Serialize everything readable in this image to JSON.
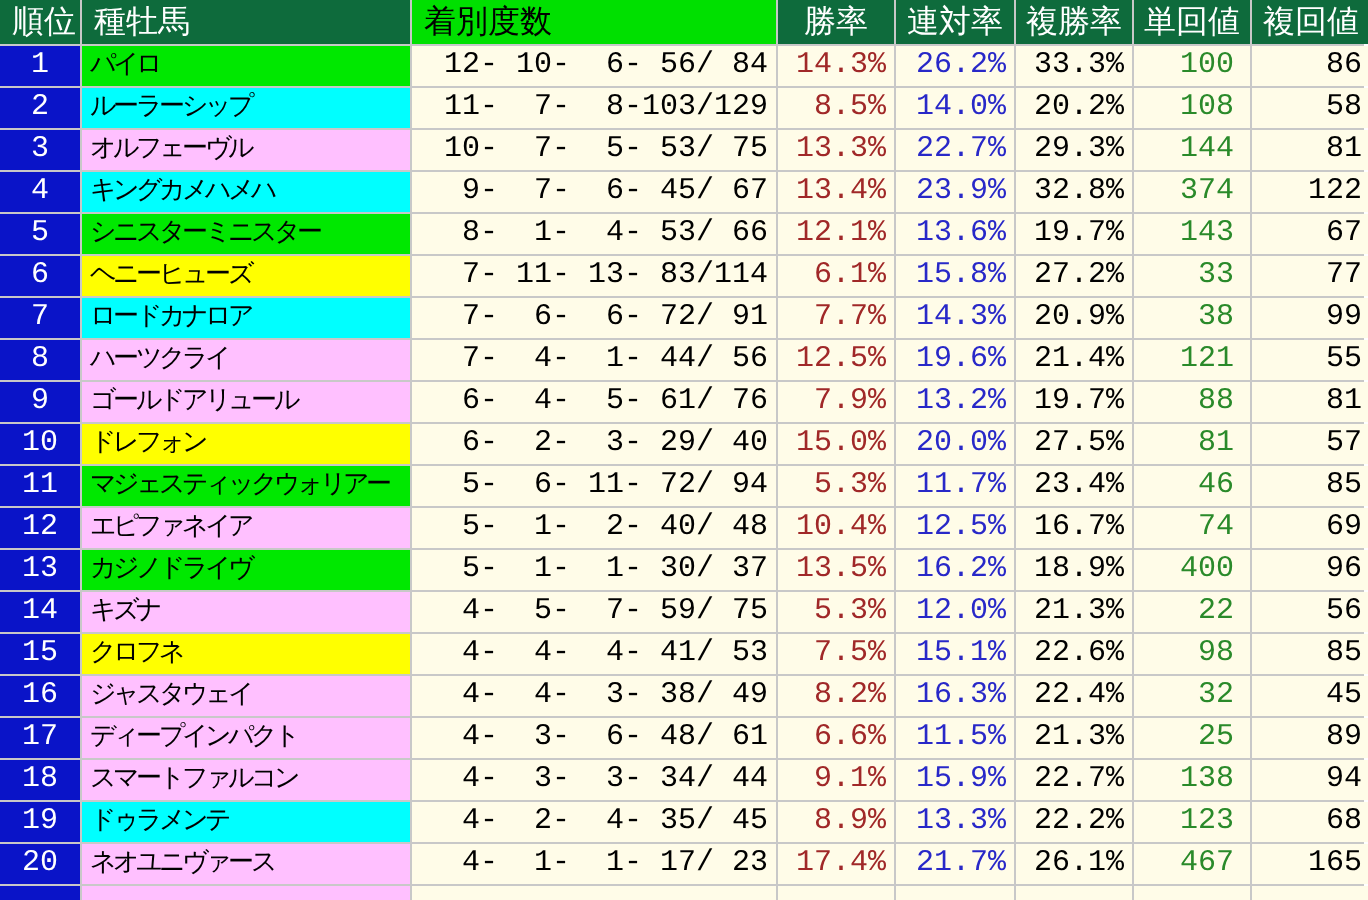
{
  "table": {
    "columns": [
      "順位",
      "種牡馬",
      "着別度数",
      "勝率",
      "連対率",
      "複勝率",
      "単回値",
      "複回値"
    ],
    "rows": [
      {
        "rank": "1",
        "sire": "パイロ",
        "color": "#00e800",
        "record": "12- 10-  6- 56/ 84",
        "win": "14.3%",
        "quinella": "26.2%",
        "place": "33.3%",
        "win_return": "100",
        "place_return": "86"
      },
      {
        "rank": "2",
        "sire": "ルーラーシップ",
        "color": "#00ffff",
        "record": "11-  7-  8-103/129",
        "win": "8.5%",
        "quinella": "14.0%",
        "place": "20.2%",
        "win_return": "108",
        "place_return": "58"
      },
      {
        "rank": "3",
        "sire": "オルフェーヴル",
        "color": "#ffc0ff",
        "record": "10-  7-  5- 53/ 75",
        "win": "13.3%",
        "quinella": "22.7%",
        "place": "29.3%",
        "win_return": "144",
        "place_return": "81"
      },
      {
        "rank": "4",
        "sire": "キングカメハメハ",
        "color": "#00ffff",
        "record": " 9-  7-  6- 45/ 67",
        "win": "13.4%",
        "quinella": "23.9%",
        "place": "32.8%",
        "win_return": "374",
        "place_return": "122"
      },
      {
        "rank": "5",
        "sire": "シニスターミニスター",
        "color": "#00e800",
        "record": " 8-  1-  4- 53/ 66",
        "win": "12.1%",
        "quinella": "13.6%",
        "place": "19.7%",
        "win_return": "143",
        "place_return": "67"
      },
      {
        "rank": "6",
        "sire": "ヘニーヒューズ",
        "color": "#ffff00",
        "record": " 7- 11- 13- 83/114",
        "win": "6.1%",
        "quinella": "15.8%",
        "place": "27.2%",
        "win_return": "33",
        "place_return": "77"
      },
      {
        "rank": "7",
        "sire": "ロードカナロア",
        "color": "#00ffff",
        "record": " 7-  6-  6- 72/ 91",
        "win": "7.7%",
        "quinella": "14.3%",
        "place": "20.9%",
        "win_return": "38",
        "place_return": "99"
      },
      {
        "rank": "8",
        "sire": "ハーツクライ",
        "color": "#ffc0ff",
        "record": " 7-  4-  1- 44/ 56",
        "win": "12.5%",
        "quinella": "19.6%",
        "place": "21.4%",
        "win_return": "121",
        "place_return": "55"
      },
      {
        "rank": "9",
        "sire": "ゴールドアリュール",
        "color": "#ffc0ff",
        "record": " 6-  4-  5- 61/ 76",
        "win": "7.9%",
        "quinella": "13.2%",
        "place": "19.7%",
        "win_return": "88",
        "place_return": "81"
      },
      {
        "rank": "10",
        "sire": "ドレフォン",
        "color": "#ffff00",
        "record": " 6-  2-  3- 29/ 40",
        "win": "15.0%",
        "quinella": "20.0%",
        "place": "27.5%",
        "win_return": "81",
        "place_return": "57"
      },
      {
        "rank": "11",
        "sire": "マジェスティックウォリアー",
        "color": "#00e800",
        "record": " 5-  6- 11- 72/ 94",
        "win": "5.3%",
        "quinella": "11.7%",
        "place": "23.4%",
        "win_return": "46",
        "place_return": "85"
      },
      {
        "rank": "12",
        "sire": "エピファネイア",
        "color": "#ffc0ff",
        "record": " 5-  1-  2- 40/ 48",
        "win": "10.4%",
        "quinella": "12.5%",
        "place": "16.7%",
        "win_return": "74",
        "place_return": "69"
      },
      {
        "rank": "13",
        "sire": "カジノドライヴ",
        "color": "#00e800",
        "record": " 5-  1-  1- 30/ 37",
        "win": "13.5%",
        "quinella": "16.2%",
        "place": "18.9%",
        "win_return": "400",
        "place_return": "96"
      },
      {
        "rank": "14",
        "sire": "キズナ",
        "color": "#ffc0ff",
        "record": " 4-  5-  7- 59/ 75",
        "win": "5.3%",
        "quinella": "12.0%",
        "place": "21.3%",
        "win_return": "22",
        "place_return": "56"
      },
      {
        "rank": "15",
        "sire": "クロフネ",
        "color": "#ffff00",
        "record": " 4-  4-  4- 41/ 53",
        "win": "7.5%",
        "quinella": "15.1%",
        "place": "22.6%",
        "win_return": "98",
        "place_return": "85"
      },
      {
        "rank": "16",
        "sire": "ジャスタウェイ",
        "color": "#ffc0ff",
        "record": " 4-  4-  3- 38/ 49",
        "win": "8.2%",
        "quinella": "16.3%",
        "place": "22.4%",
        "win_return": "32",
        "place_return": "45"
      },
      {
        "rank": "17",
        "sire": "ディープインパクト",
        "color": "#ffc0ff",
        "record": " 4-  3-  6- 48/ 61",
        "win": "6.6%",
        "quinella": "11.5%",
        "place": "21.3%",
        "win_return": "25",
        "place_return": "89"
      },
      {
        "rank": "18",
        "sire": "スマートファルコン",
        "color": "#ffc0ff",
        "record": " 4-  3-  3- 34/ 44",
        "win": "9.1%",
        "quinella": "15.9%",
        "place": "22.7%",
        "win_return": "138",
        "place_return": "94"
      },
      {
        "rank": "19",
        "sire": "ドゥラメンテ",
        "color": "#00ffff",
        "record": " 4-  2-  4- 35/ 45",
        "win": "8.9%",
        "quinella": "13.3%",
        "place": "22.2%",
        "win_return": "123",
        "place_return": "68"
      },
      {
        "rank": "20",
        "sire": "ネオユニヴァース",
        "color": "#ffc0ff",
        "record": " 4-  1-  1- 17/ 23",
        "win": "17.4%",
        "quinella": "21.7%",
        "place": "26.1%",
        "win_return": "467",
        "place_return": "165"
      }
    ]
  }
}
